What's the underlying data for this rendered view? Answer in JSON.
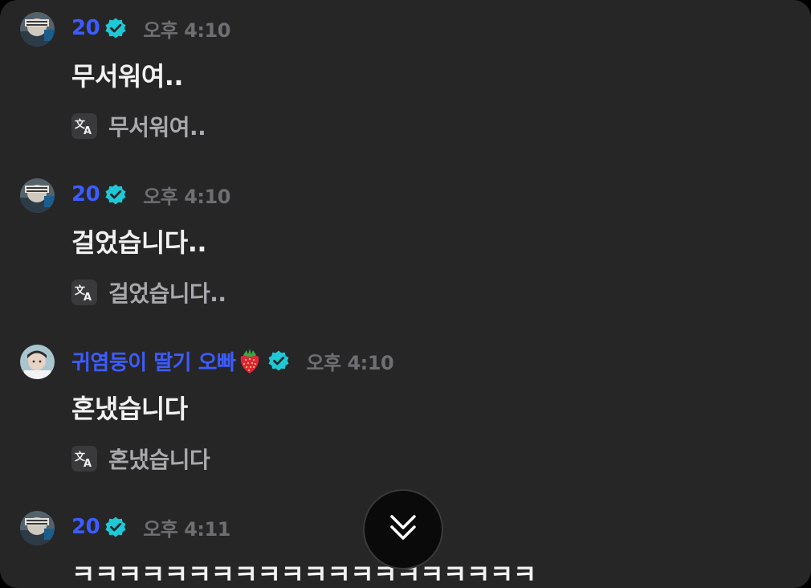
{
  "messages": [
    {
      "author": "20",
      "time": "오후 4:10",
      "text": "무서워여..",
      "translation": "무서워여.."
    },
    {
      "author": "20",
      "time": "오후 4:10",
      "text": "걸었습니다..",
      "translation": "걸었습니다.."
    },
    {
      "author": "귀염둥이 딸기 오빠",
      "author_emoji": "strawberry",
      "time": "오후 4:10",
      "text": "혼냈습니다",
      "translation": "혼냈습니다"
    },
    {
      "author": "20",
      "time": "오후 4:11",
      "text": "ㅋㅋㅋㅋㅋㅋㅋㅋㅋㅋㅋㅋㅋㅋㅋㅋㅋㅋㅋㅋ"
    }
  ],
  "icons": {
    "verified": "verified-badge-icon",
    "translate": "translate-icon",
    "scroll": "double-chevron-down-icon"
  },
  "colors": {
    "background": "#262627",
    "author": "#3d5cff",
    "verified": "#1ec8d6",
    "timestamp": "#6e6e73",
    "message_text": "#f2f2f2",
    "translation_text": "#a9a9ad"
  }
}
